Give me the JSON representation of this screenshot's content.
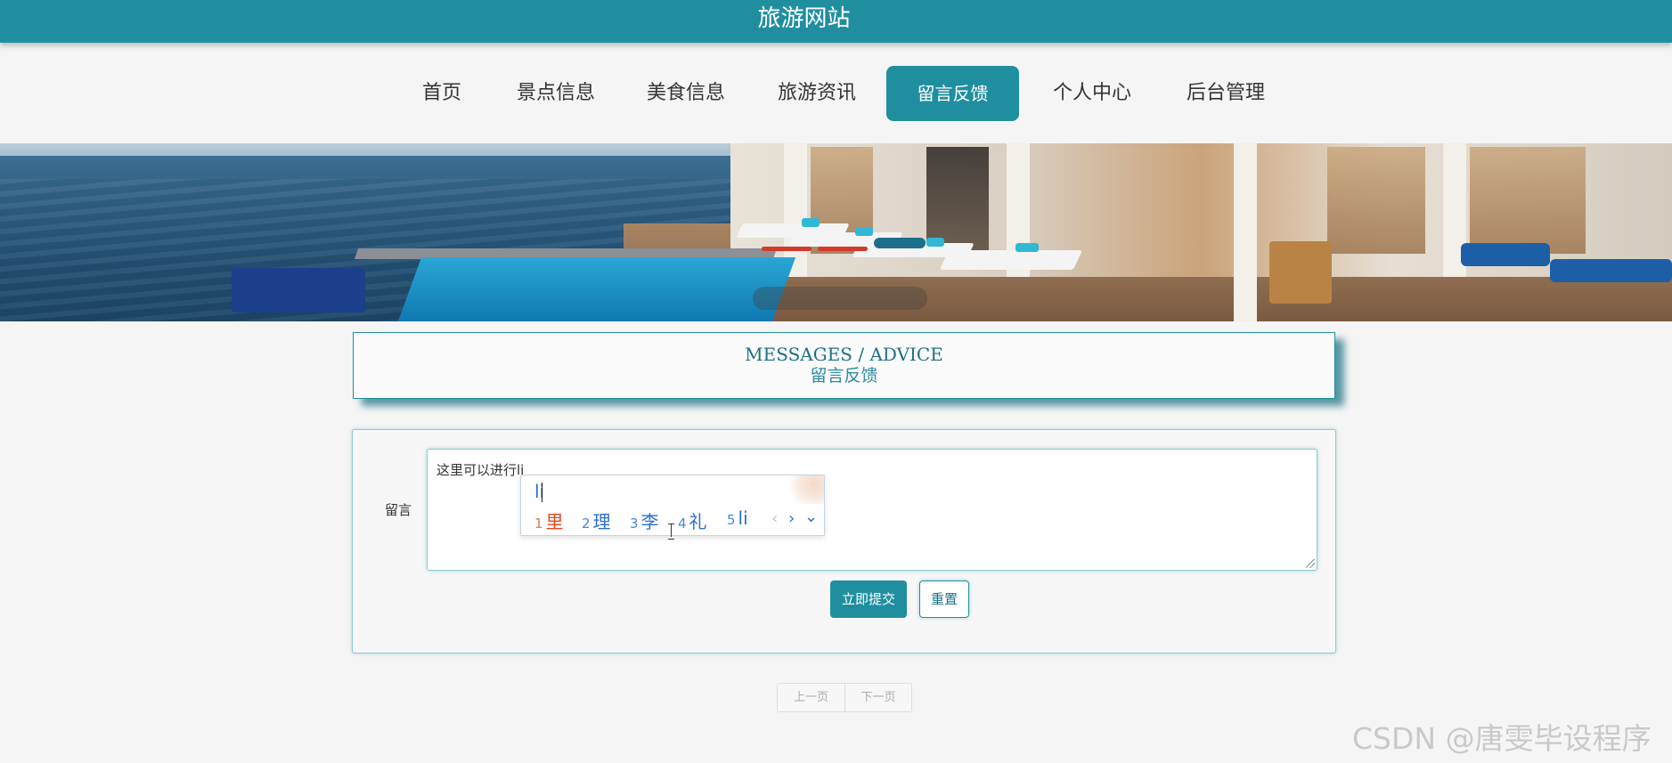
{
  "header": {
    "site_title": "旅游网站"
  },
  "nav": {
    "items": [
      {
        "label": "首页"
      },
      {
        "label": "景点信息"
      },
      {
        "label": "美食信息"
      },
      {
        "label": "旅游资讯"
      },
      {
        "label": "留言反馈",
        "active": true
      },
      {
        "label": "个人中心"
      },
      {
        "label": "后台管理"
      }
    ]
  },
  "banner": {
    "slide_count": 3,
    "active_slide": 3
  },
  "section": {
    "title_en": "MESSAGES / ADVICE",
    "title_cn": "留言反馈"
  },
  "form": {
    "message_label": "留言",
    "message_value": "这里可以进行li",
    "submit_label": "立即提交",
    "reset_label": "重置"
  },
  "ime": {
    "composition": "li",
    "candidates": [
      {
        "num": "1",
        "text": "里"
      },
      {
        "num": "2",
        "text": "理"
      },
      {
        "num": "3",
        "text": "李"
      },
      {
        "num": "4",
        "text": "礼"
      },
      {
        "num": "5",
        "text": "li"
      }
    ],
    "prev_icon": "chevron-left-icon",
    "next_icon": "chevron-right-icon",
    "expand_icon": "chevron-down-icon"
  },
  "pager": {
    "prev_label": "上一页",
    "next_label": "下一页"
  },
  "watermark": {
    "text": "CSDN @唐雯毕设程序"
  },
  "colors": {
    "primary": "#1f8fa0",
    "accent_dark": "#1c6f8a",
    "background": "#f5f5f5"
  }
}
